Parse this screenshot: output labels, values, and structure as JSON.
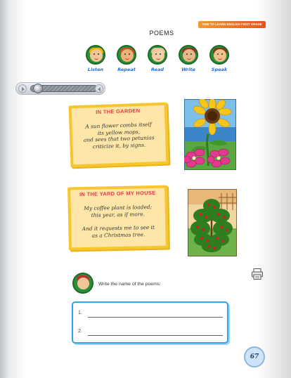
{
  "header": {
    "banner": "TIME TO LEARN ENGLISH FIRST GRADE",
    "title": "POEMS"
  },
  "skills": [
    {
      "label": "Listen",
      "icon": "listen-icon"
    },
    {
      "label": "Repeat",
      "icon": "repeat-icon"
    },
    {
      "label": "Read",
      "icon": "read-icon"
    },
    {
      "label": "Write",
      "icon": "write-icon"
    },
    {
      "label": "Speak",
      "icon": "speak-icon"
    }
  ],
  "audio_player": {
    "progress": 0.05
  },
  "poems": [
    {
      "title": "IN THE GARDEN",
      "lines": [
        "A sun flower combs itself",
        "its yellow mops,",
        "and sees that two petunias",
        "criticize it, by signs."
      ]
    },
    {
      "title": "IN THE YARD OF MY HOUSE",
      "lines": [
        "My coffee plant is loaded;",
        "this year, as if more.",
        "And it requests me to see it",
        "as a Christmas tree."
      ]
    }
  ],
  "activity": {
    "instruction": "Write the name of the poems:",
    "answers": [
      {
        "number": "1.",
        "value": ""
      },
      {
        "number": "2.",
        "value": ""
      }
    ]
  },
  "page_number": "67",
  "colors": {
    "banner": "#ee7a26",
    "skill_label": "#1f6fd1",
    "poem_title": "#e13a4a",
    "card_fill": "#fde6a8",
    "card_border": "#f7c62f",
    "answer_border": "#2ea6e0"
  }
}
